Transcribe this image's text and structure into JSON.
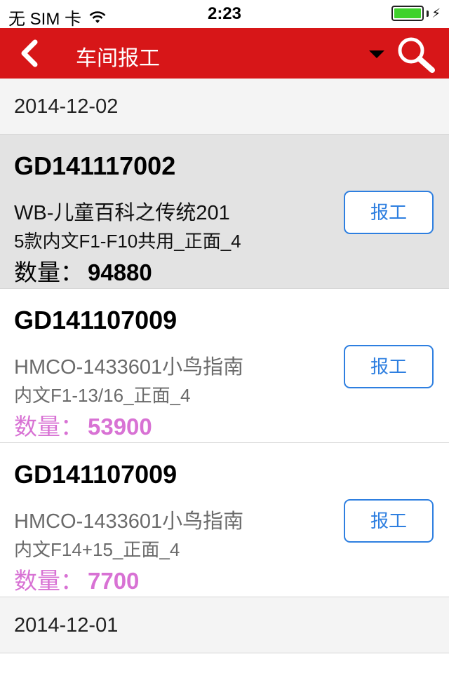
{
  "status_bar": {
    "carrier": "无 SIM 卡",
    "time": "2:23",
    "battery_level": 1.0,
    "battery_color": "#3fd22c",
    "signal_icon": "wifi-icon"
  },
  "nav": {
    "title": "车间报工",
    "back_icon": "back-chevron-icon",
    "dropdown_icon": "dropdown-triangle-icon",
    "search_icon": "search-icon",
    "bar_color": "#d71618"
  },
  "sections": [
    {
      "date": "2014-12-02",
      "items": [
        {
          "code": "GD141117002",
          "line1": "WB-儿童百科之传统201",
          "line2": "5款内文F1-F10共用_正面_4",
          "qty_label": "数量：",
          "qty_value": "94880",
          "button": "报工",
          "selected": true
        },
        {
          "code": "GD141107009",
          "line1": "HMCO-1433601小鸟指南",
          "line2": "内文F1-13/16_正面_4",
          "qty_label": "数量：",
          "qty_value": "53900",
          "button": "报工",
          "selected": false
        },
        {
          "code": "GD141107009",
          "line1": "HMCO-1433601小鸟指南",
          "line2": "内文F14+15_正面_4",
          "qty_label": "数量：",
          "qty_value": "7700",
          "button": "报工",
          "selected": false
        }
      ]
    },
    {
      "date": "2014-12-01",
      "items": []
    }
  ],
  "colors": {
    "quantity_highlight": "#d872d4",
    "button_accent": "#2e7fe0"
  }
}
